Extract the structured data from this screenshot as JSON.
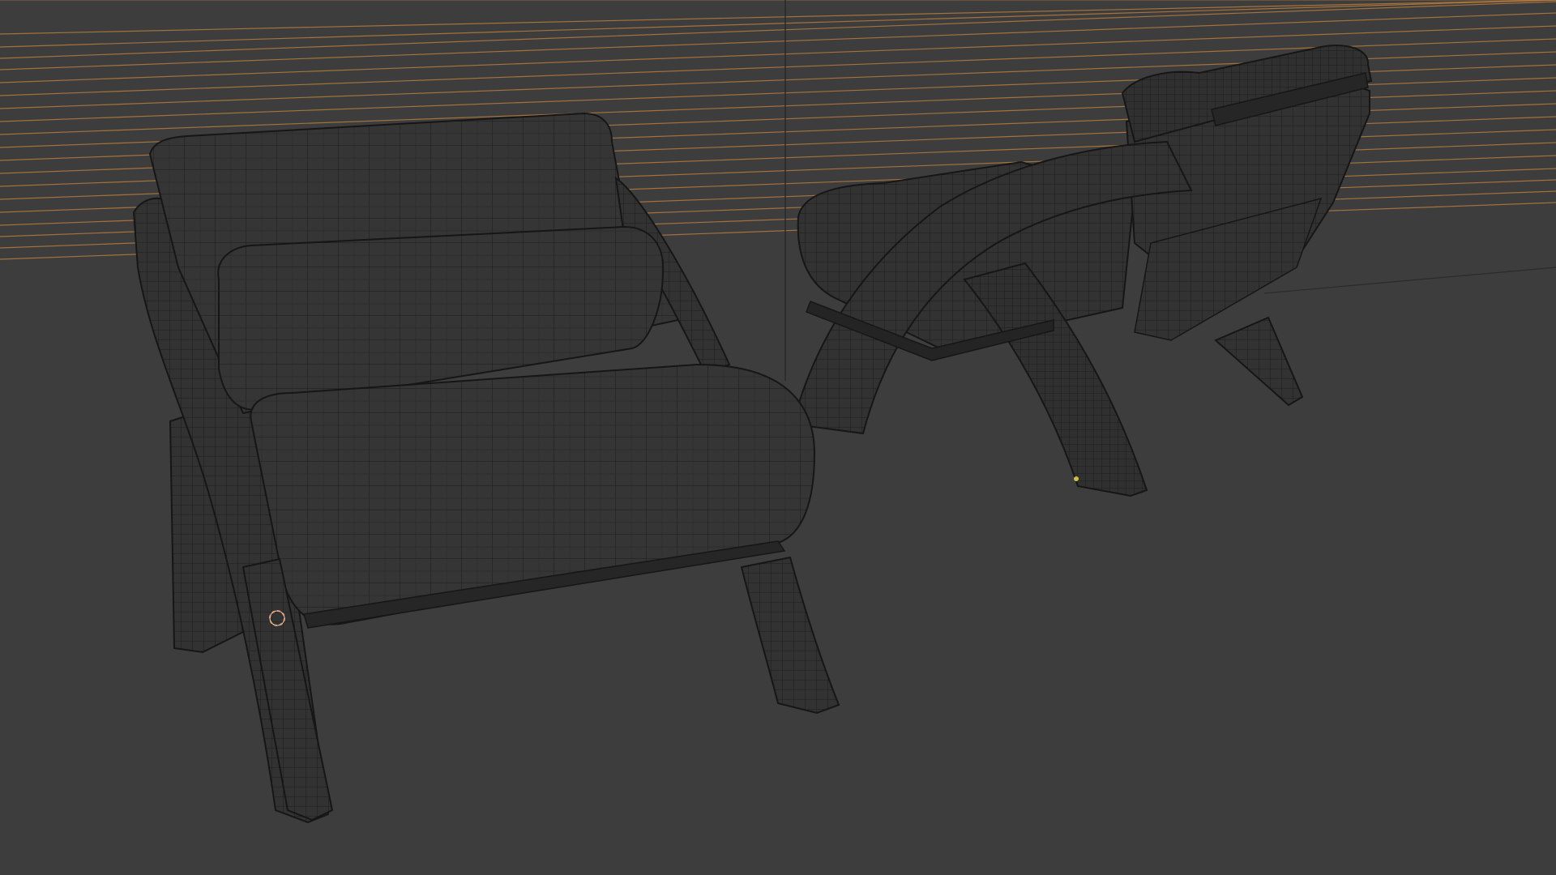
{
  "viewport": {
    "background_color": "#3d3d3d",
    "mode": "wireframe"
  },
  "colors": {
    "grid_line": "#c8843e",
    "mesh_fill": "#343434",
    "mesh_fill_dark": "#2a2a2a",
    "wire": "#1e1e1e",
    "wire_light": "#4a4a4a",
    "outline": "#161616",
    "axis_line": "#5a5a5a",
    "cursor": "#e8a070",
    "origin_dot": "#d0c040"
  },
  "objects": [
    {
      "name": "armchair-front",
      "selected": false
    },
    {
      "name": "armchair-back",
      "selected": false
    }
  ],
  "cursor_3d": {
    "icon": "3d-cursor-icon"
  },
  "object_origin": {
    "icon": "origin-dot-icon"
  }
}
